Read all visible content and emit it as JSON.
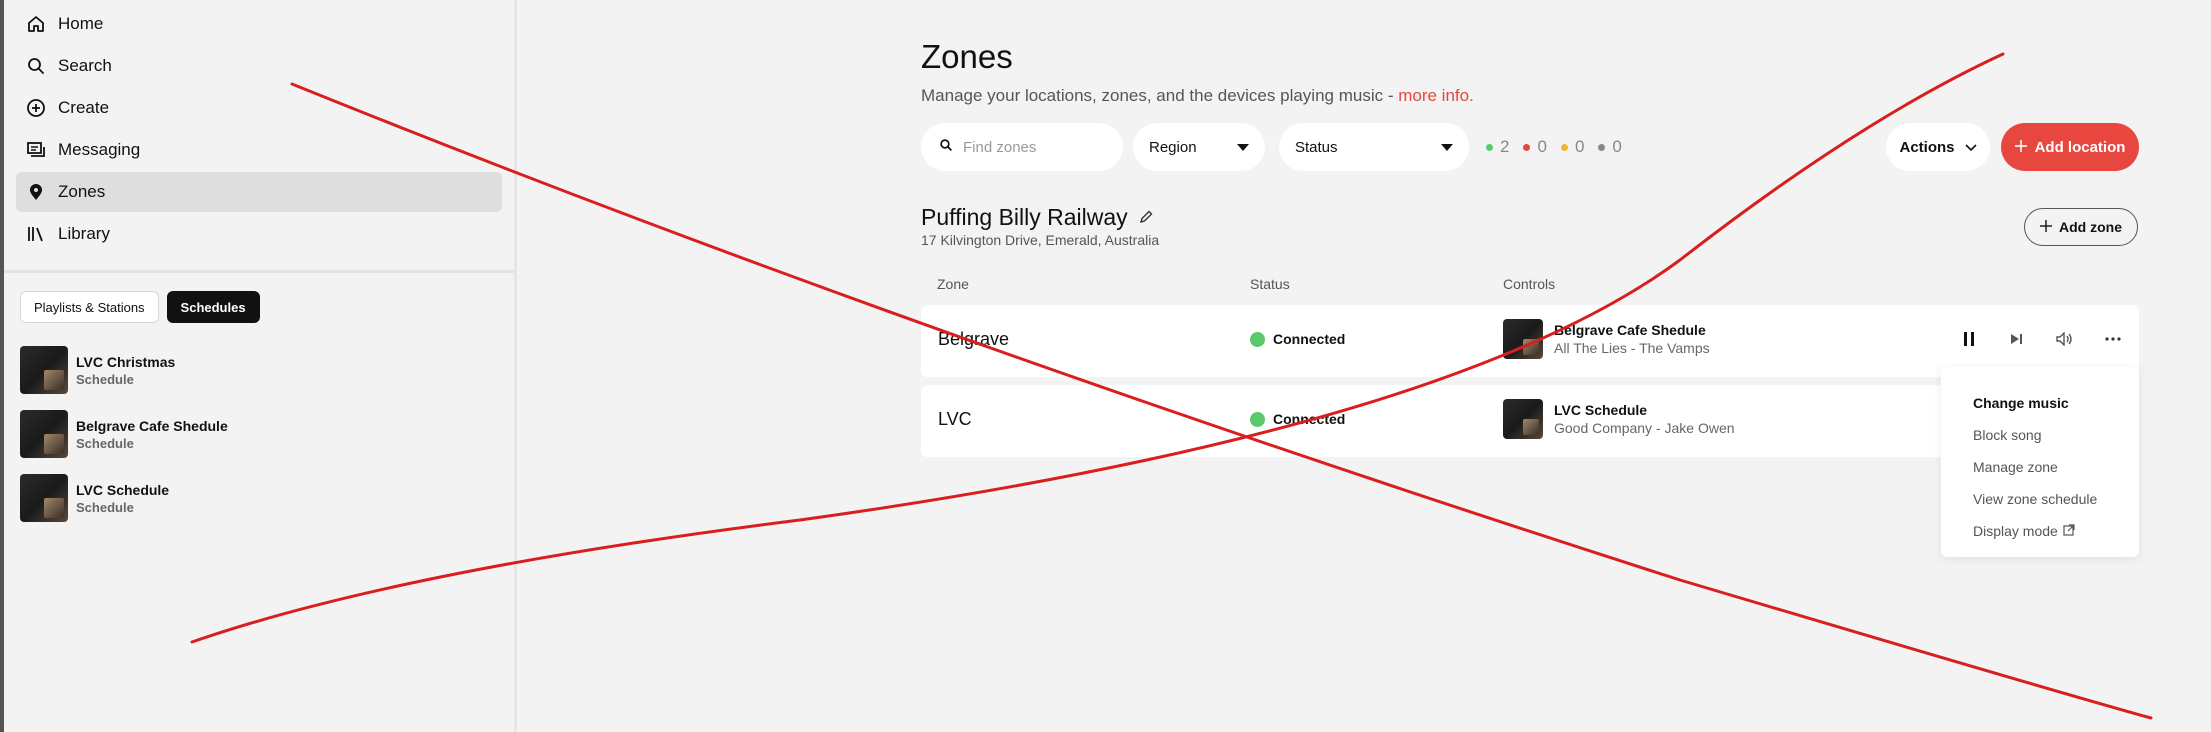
{
  "sidebar": {
    "nav": [
      {
        "label": "Home",
        "icon": "home-icon"
      },
      {
        "label": "Search",
        "icon": "search-icon"
      },
      {
        "label": "Create",
        "icon": "plus-circle-icon"
      },
      {
        "label": "Messaging",
        "icon": "messaging-icon"
      },
      {
        "label": "Zones",
        "icon": "location-pin-icon",
        "active": true
      },
      {
        "label": "Library",
        "icon": "library-icon"
      }
    ],
    "chips": {
      "playlists": "Playlists & Stations",
      "schedules": "Schedules"
    },
    "library": [
      {
        "title": "LVC Christmas",
        "subtitle": "Schedule"
      },
      {
        "title": "Belgrave Cafe Shedule",
        "subtitle": "Schedule"
      },
      {
        "title": "LVC Schedule",
        "subtitle": "Schedule"
      }
    ]
  },
  "main": {
    "title": "Zones",
    "subtitle": "Manage your locations, zones, and the devices playing music -",
    "more_info": "more info.",
    "search_placeholder": "Find zones",
    "region_label": "Region",
    "status_label": "Status",
    "counts": [
      {
        "value": "2",
        "color": "#5ac96b"
      },
      {
        "value": "0",
        "color": "#e8473f"
      },
      {
        "value": "0",
        "color": "#f2b531"
      },
      {
        "value": "0",
        "color": "#888888"
      }
    ],
    "actions_label": "Actions",
    "add_location_label": "Add location",
    "location": {
      "name": "Puffing Billy Railway",
      "address": "17 Kilvington Drive, Emerald, Australia",
      "add_zone_label": "Add zone"
    },
    "table_headers": {
      "zone": "Zone",
      "status": "Status",
      "controls": "Controls"
    },
    "zones": [
      {
        "name": "Belgrave",
        "status": "Connected",
        "playing_title": "Belgrave Cafe Shedule",
        "playing_sub": "All The Lies - The Vamps"
      },
      {
        "name": "LVC",
        "status": "Connected",
        "playing_title": "LVC Schedule",
        "playing_sub": "Good Company - Jake Owen"
      }
    ],
    "menu": [
      "Change music",
      "Block song",
      "Manage zone",
      "View zone schedule",
      "Display mode"
    ]
  },
  "colors": {
    "accent": "#e8473f",
    "connected": "#5ac96b",
    "overlay_line": "#d91e1e"
  }
}
